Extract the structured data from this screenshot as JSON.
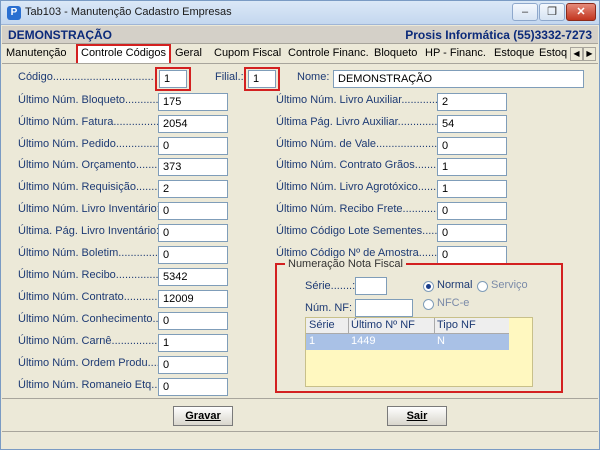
{
  "window": {
    "title": "Tab103 - Manutenção Cadastro Empresas",
    "minimize": "–",
    "restore": "❐",
    "close": "✕",
    "app_icon": "P"
  },
  "header": {
    "company": "DEMONSTRAÇÃO",
    "vendor": "Prosis Informática (55)3332-7273"
  },
  "tabs": [
    {
      "label": "Manutenção"
    },
    {
      "label": "Controle Códigos",
      "active": true
    },
    {
      "label": "Geral"
    },
    {
      "label": "Cupom Fiscal"
    },
    {
      "label": "Controle Financ."
    },
    {
      "label": "Bloqueto"
    },
    {
      "label": "HP - Financ."
    },
    {
      "label": "Estoque"
    },
    {
      "label": "Estoq"
    }
  ],
  "tab_arrows": {
    "left": "◀",
    "right": "▶"
  },
  "top_row": {
    "codigo_label": "Código............................................:",
    "codigo_value": "1",
    "filial_label": "Filial.:",
    "filial_value": "1",
    "nome_label": "Nome:",
    "nome_value": "DEMONSTRAÇÃO"
  },
  "left_fields": [
    {
      "label": "Último Núm. Bloqueto...........:",
      "value": "175"
    },
    {
      "label": "Último Núm. Fatura.................:",
      "value": "2054"
    },
    {
      "label": "Último Núm. Pedido.................:",
      "value": "0"
    },
    {
      "label": "Último Núm. Orçamento.........:",
      "value": "373"
    },
    {
      "label": "Último Núm. Requisição........:",
      "value": "2"
    },
    {
      "label": "Último Núm. Livro Inventário:",
      "value": "0"
    },
    {
      "label": "Última. Pág. Livro Inventário:",
      "value": "0"
    },
    {
      "label": "Último Núm. Boletim..............:",
      "value": "0"
    },
    {
      "label": "Último Núm. Recibo..............:",
      "value": "5342"
    },
    {
      "label": "Último Núm. Contrato............:",
      "value": "12009"
    },
    {
      "label": "Último Núm. Conhecimento..:",
      "value": "0"
    },
    {
      "label": "Último Núm. Carnê...............:",
      "value": "1"
    },
    {
      "label": "Último Núm. Ordem Produ....:",
      "value": "0"
    },
    {
      "label": "Último Núm. Romaneio Etq..:",
      "value": "0"
    }
  ],
  "right_fields": [
    {
      "label": "Último Núm. Livro Auxiliar..............:",
      "value": "2"
    },
    {
      "label": "Última Pág. Livro Auxiliar...............:",
      "value": "54"
    },
    {
      "label": "Último Núm. de Vale.........................:",
      "value": "0"
    },
    {
      "label": "Último Núm. Contrato Grãos...........:",
      "value": "1"
    },
    {
      "label": "Último Núm. Livro Agrotóxico..........:",
      "value": "1"
    },
    {
      "label": "Último Núm. Recibo Frete...............:",
      "value": "0"
    },
    {
      "label": "Último Código Lote Sementes.......:",
      "value": "0"
    },
    {
      "label": "Último Código Nº de Amostra.......:",
      "value": "0"
    }
  ],
  "nota_fiscal": {
    "group_title": "Numeração Nota Fiscal",
    "serie_label": "Série.......:",
    "serie_value": "",
    "num_label": "Núm. NF:",
    "num_value": "",
    "radio_normal": "Normal",
    "radio_servico": "Serviço",
    "radio_nfce": "NFC-e",
    "selected": "Normal",
    "grid_headers": [
      "Série",
      "Último Nº NF",
      "Tipo NF"
    ],
    "grid_rows": [
      {
        "serie": "1",
        "ultimo": "1449",
        "tipo": "N"
      }
    ]
  },
  "footer": {
    "gravar": "Gravar",
    "sair": "Sair"
  }
}
